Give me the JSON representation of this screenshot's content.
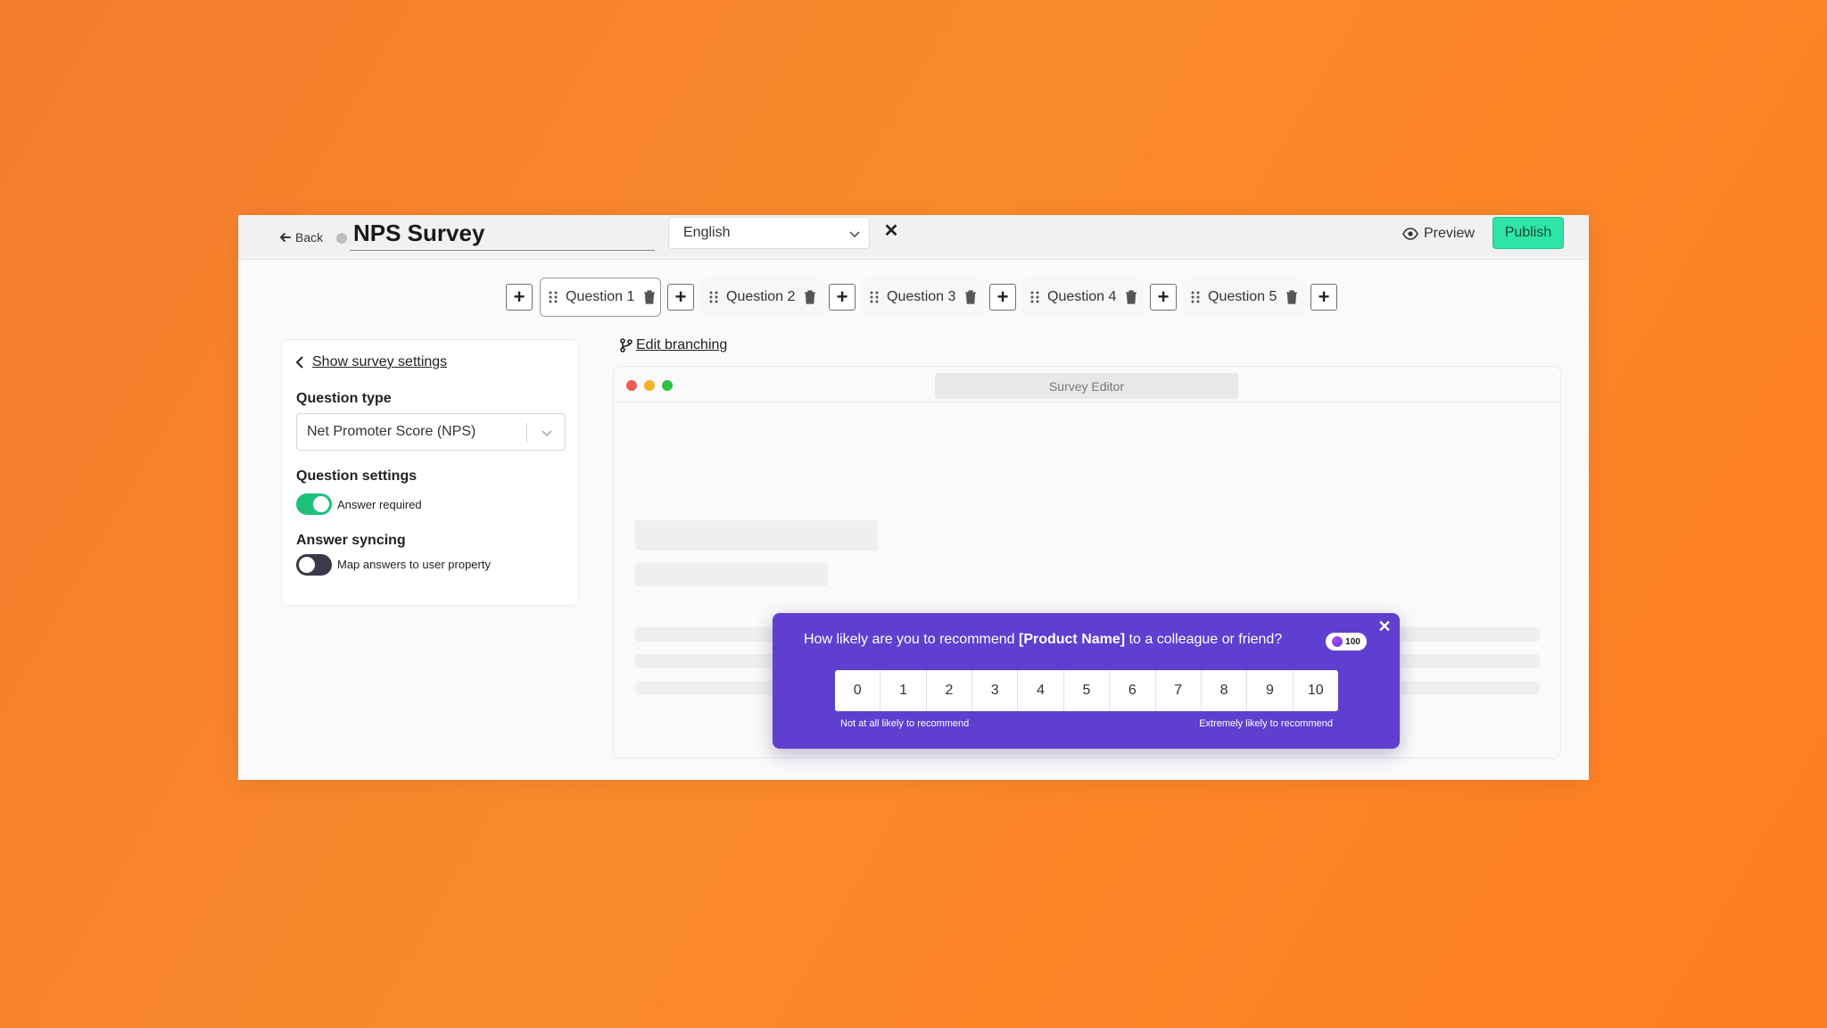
{
  "header": {
    "back_label": "Back",
    "title": "NPS Survey",
    "language": "English",
    "close_symbol": "✕",
    "preview_label": "Preview",
    "publish_label": "Publish"
  },
  "tabs": [
    {
      "label": "Question 1",
      "active": true
    },
    {
      "label": "Question 2",
      "active": false
    },
    {
      "label": "Question 3",
      "active": false
    },
    {
      "label": "Question 4",
      "active": false
    },
    {
      "label": "Question 5",
      "active": false
    }
  ],
  "add_symbol": "+",
  "panel": {
    "settings_link": "Show survey settings",
    "question_type_label": "Question type",
    "question_type_value": "Net Promoter Score (NPS)",
    "question_settings_label": "Question settings",
    "answer_required_label": "Answer required",
    "answer_required": true,
    "answer_syncing_label": "Answer syncing",
    "map_answers_label": "Map answers to user property",
    "map_answers": false
  },
  "editor": {
    "edit_branching_label": "Edit branching",
    "url_bar": "Survey Editor"
  },
  "nps": {
    "question_prefix": "How likely are you to recommend ",
    "question_product": "[Product Name]",
    "question_suffix": " to a colleague or friend?",
    "badge_value": "100",
    "close_symbol": "✕",
    "scale": [
      "0",
      "1",
      "2",
      "3",
      "4",
      "5",
      "6",
      "7",
      "8",
      "9",
      "10"
    ],
    "low_label": "Not at all likely to recommend",
    "high_label": "Extremely likely to recommend"
  },
  "colors": {
    "publish": "#2ee5a6",
    "toggle_on": "#1ec17b",
    "toggle_off": "#3a3a4a",
    "nps_bg": "#5e3fd0",
    "dot_red": "#ee5b52",
    "dot_yellow": "#f4b32c",
    "dot_green": "#2cc243"
  }
}
